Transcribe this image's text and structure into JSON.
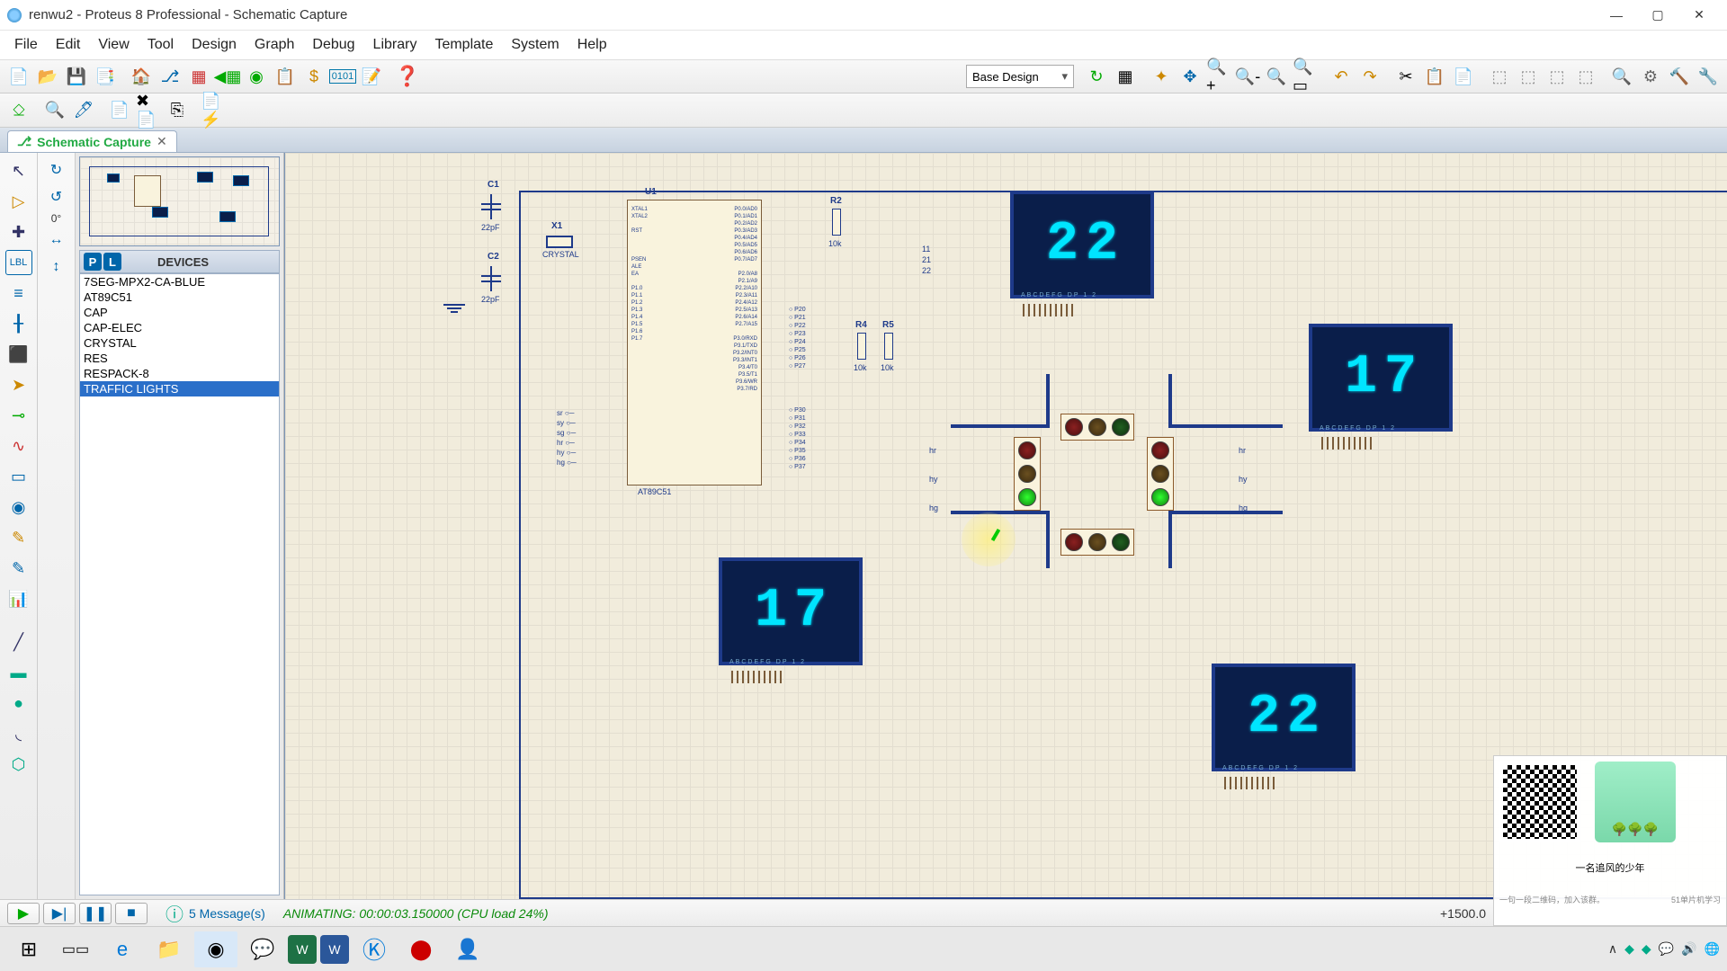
{
  "window": {
    "title": "renwu2 - Proteus 8 Professional - Schematic Capture",
    "minimize": "—",
    "maximize": "▢",
    "close": "✕"
  },
  "menu": {
    "items": [
      "File",
      "Edit",
      "View",
      "Tool",
      "Design",
      "Graph",
      "Debug",
      "Library",
      "Template",
      "System",
      "Help"
    ]
  },
  "toolbar": {
    "design_combo": "Base Design"
  },
  "tab": {
    "label": "Schematic Capture",
    "close": "✕"
  },
  "rotation": "0°",
  "devices": {
    "header": "DEVICES",
    "p": "P",
    "l": "L",
    "items": [
      "7SEG-MPX2-CA-BLUE",
      "AT89C51",
      "CAP",
      "CAP-ELEC",
      "CRYSTAL",
      "RES",
      "RESPACK-8",
      "TRAFFIC LIGHTS"
    ],
    "selected_index": 7
  },
  "schematic": {
    "u1": {
      "ref": "U1",
      "val": "AT89C51",
      "left_pins": [
        "XTAL1",
        "XTAL2",
        "",
        "RST",
        "",
        "",
        "",
        "PSEN",
        "ALE",
        "EA",
        "",
        "P1.0",
        "P1.1",
        "P1.2",
        "P1.3",
        "P1.4",
        "P1.5",
        "P1.6",
        "P1.7"
      ],
      "right_pins": [
        "P0.0/AD0",
        "P0.1/AD1",
        "P0.2/AD2",
        "P0.3/AD3",
        "P0.4/AD4",
        "P0.5/AD5",
        "P0.6/AD6",
        "P0.7/AD7",
        "",
        "P2.0/A8",
        "P2.1/A9",
        "P2.2/A10",
        "P2.3/A11",
        "P2.4/A12",
        "P2.5/A13",
        "P2.6/A14",
        "P2.7/A15",
        "",
        "P3.0/RXD",
        "P3.1/TXD",
        "P3.2/INT0",
        "P3.3/INT1",
        "P3.4/T0",
        "P3.5/T1",
        "P3.6/WR",
        "P3.7/RD"
      ]
    },
    "c1": {
      "ref": "C1",
      "val": "22pF"
    },
    "c2": {
      "ref": "C2",
      "val": "22pF"
    },
    "x1": {
      "ref": "X1",
      "val": "CRYSTAL"
    },
    "r2": {
      "ref": "R2",
      "val": "10k"
    },
    "r4": {
      "ref": "R4",
      "val": "10k"
    },
    "r5": {
      "ref": "R5",
      "val": "10k"
    },
    "net_labels": [
      "sr",
      "sy",
      "sg",
      "hr",
      "hy",
      "hg"
    ],
    "pin_nums_right": [
      "11",
      "21",
      "22"
    ],
    "p2_nets": [
      "P20",
      "P21",
      "P22",
      "P23",
      "P24",
      "P25",
      "P26",
      "P27"
    ],
    "p3_nets": [
      "P30",
      "P31",
      "P32",
      "P33",
      "P34",
      "P35",
      "P36",
      "P37"
    ],
    "seg_legend": "ABCDEFG  DP    1 2",
    "displays": {
      "north": "22",
      "east": "17",
      "south": "22",
      "west": "17"
    }
  },
  "status": {
    "messages_icon": "ⓘ",
    "messages": "5 Message(s)",
    "animating": "ANIMATING: 00:00:03.150000 (CPU load 24%)",
    "coord": "+1500.0"
  },
  "qr": {
    "caption1": "一名追风的少年",
    "caption2": "51单片机学习",
    "caption3": "一句一段二维码，加入该群。"
  },
  "tray": {
    "chevron": "∧"
  }
}
